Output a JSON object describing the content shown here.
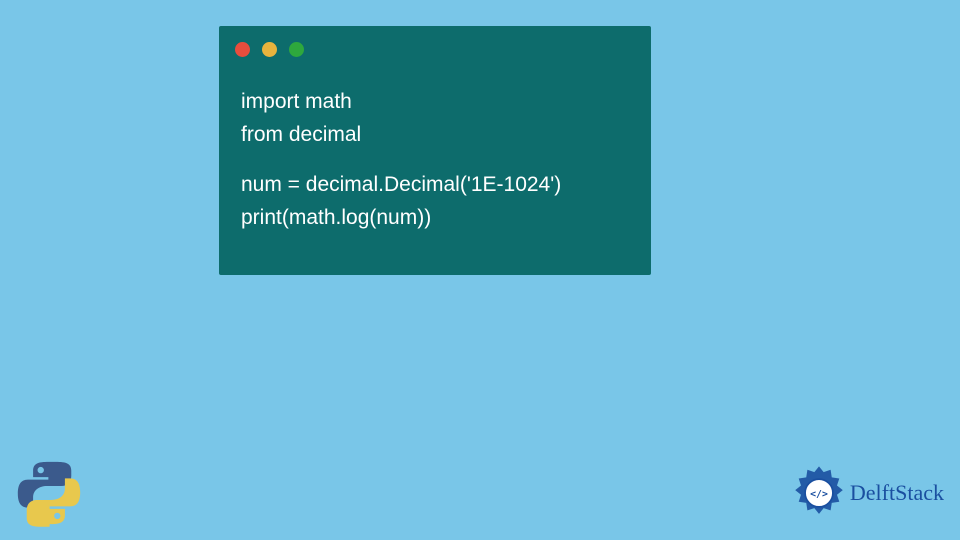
{
  "code": {
    "line1": "import math",
    "line2": "from decimal",
    "line3": "num = decimal.Decimal('1E-1024')",
    "line4": "print(math.log(num))"
  },
  "branding": {
    "name": "DelftStack"
  }
}
